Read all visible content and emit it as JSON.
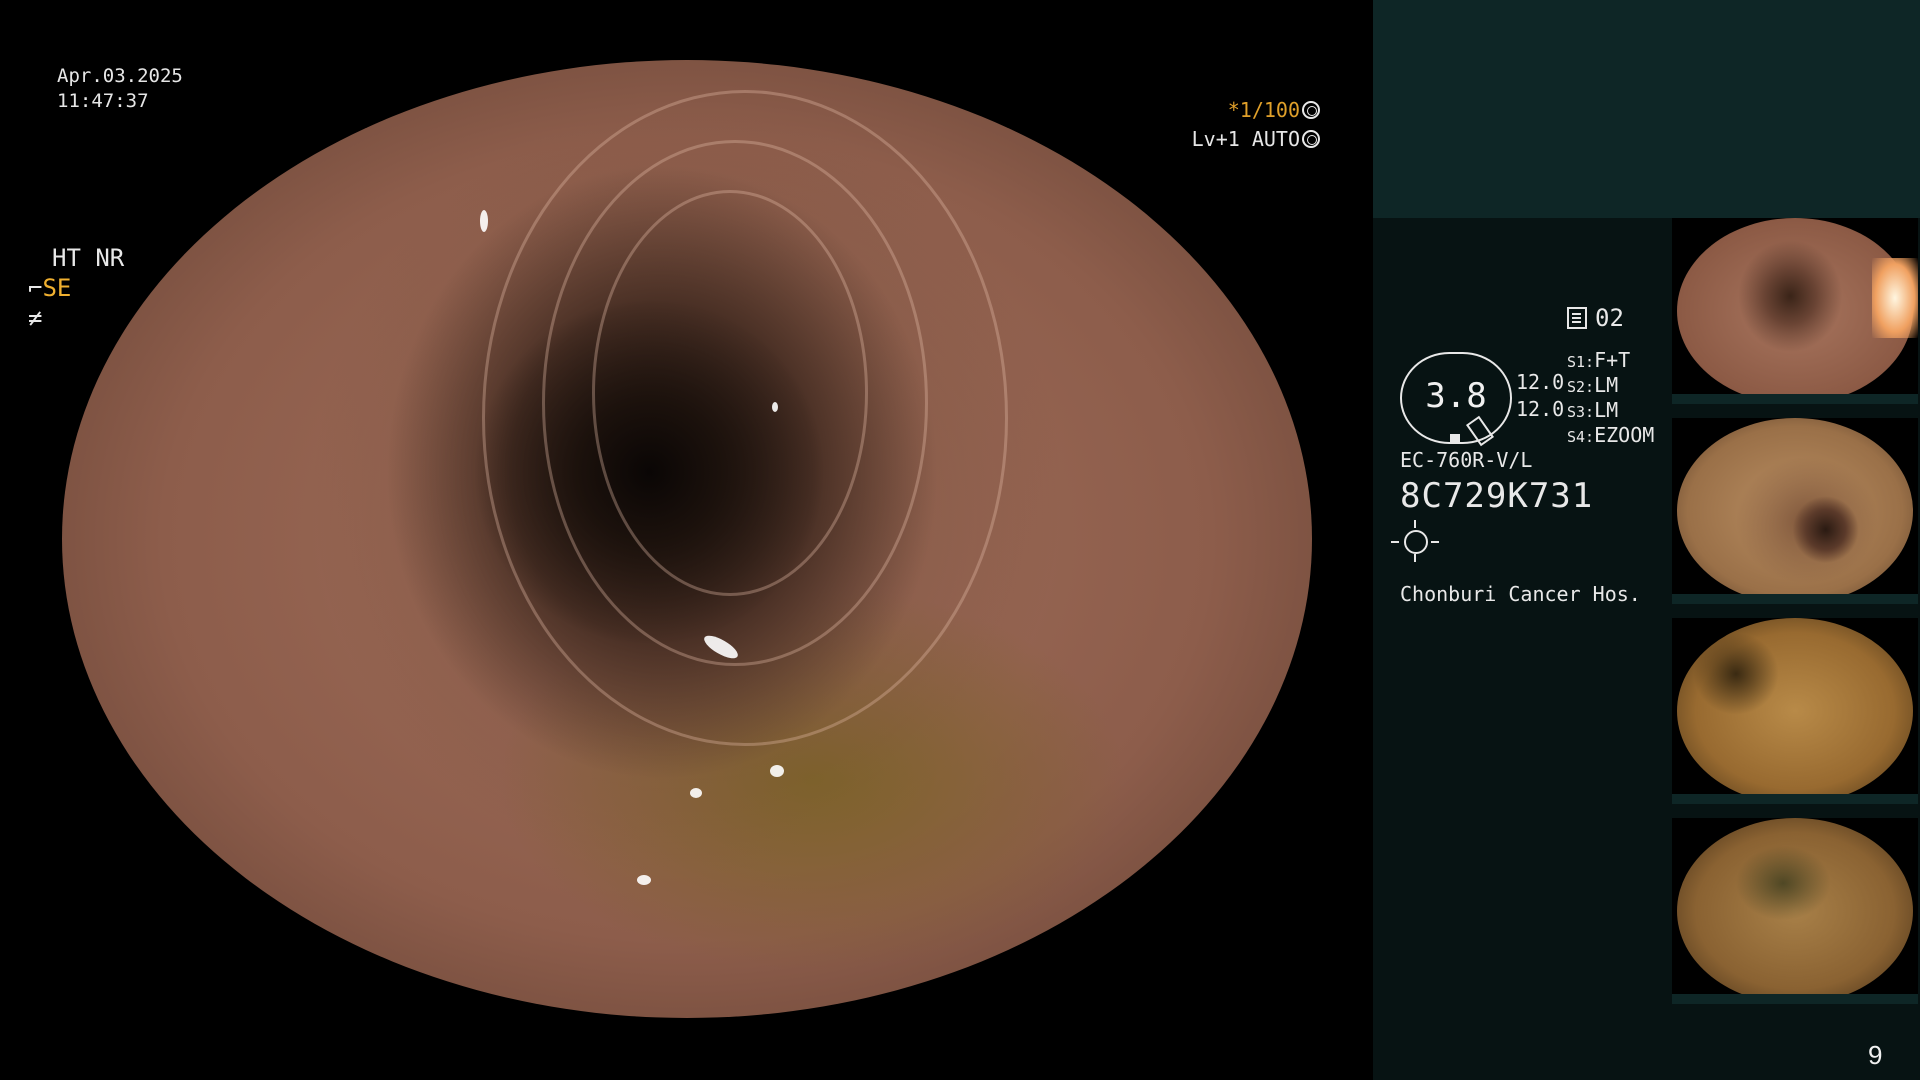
{
  "main": {
    "date": "Apr.03.2025",
    "time": "11:47:37",
    "shutter_prefix": "*",
    "shutter_value": "1/100",
    "level_auto": "Lv+1 AUTO"
  },
  "panel": {
    "mode_top": "HT NR",
    "se_label": "SE",
    "page_index": "02",
    "zoom_value": "3.8",
    "value_a": "12.0",
    "value_b": "12.0",
    "settings": [
      {
        "key": "S1:",
        "value": "F+T"
      },
      {
        "key": "S2:",
        "value": "LM"
      },
      {
        "key": "S3:",
        "value": "LM"
      },
      {
        "key": "S4:",
        "value": "EZOOM"
      }
    ],
    "scope_model": "EC-760R-V/L",
    "scope_serial": "8C729K731",
    "hospital": "Chonburi Cancer Hos."
  },
  "thumbnails": [
    {
      "label": "thumbnail-1"
    },
    {
      "label": "thumbnail-2"
    },
    {
      "label": "thumbnail-3"
    },
    {
      "label": "thumbnail-4"
    }
  ],
  "footer": {
    "slide_number": "9"
  },
  "colors": {
    "accent_orange": "#f0b030",
    "panel_bg": "#071313",
    "panel_top_bg": "#0e2626"
  }
}
